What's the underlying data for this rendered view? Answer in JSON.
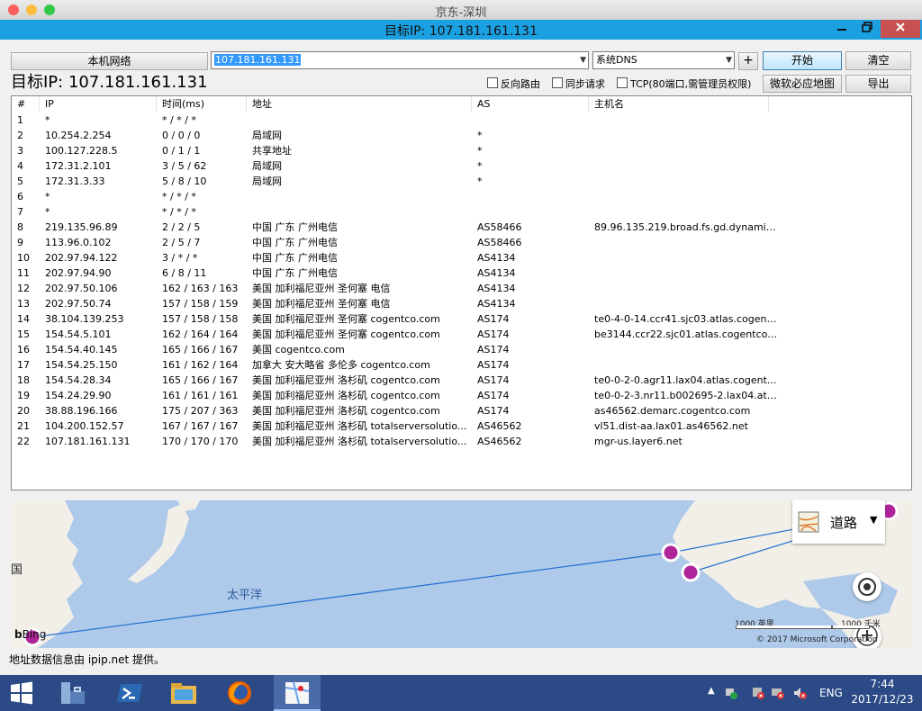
{
  "window": {
    "mac_title": "京东-深圳",
    "title": "目标IP: 107.181.161.131",
    "min_icon": "minimize-icon",
    "max_icon": "restore-icon",
    "close_icon": "close-icon"
  },
  "toolbar": {
    "local_network_label": "本机网络",
    "target_value": "107.181.161.131",
    "dns_value": "系统DNS",
    "plus_label": "+",
    "start_label": "开始",
    "clear_label": "清空",
    "bing_map_label": "微软必应地图",
    "export_label": "导出",
    "reverse_route_label": "反向路由",
    "sync_request_label": "同步请求",
    "tcp_label": "TCP(80端口,需管理员权限)"
  },
  "target_heading": "目标IP:  107.181.161.131",
  "table": {
    "columns": [
      "#",
      "IP",
      "时间(ms)",
      "地址",
      "AS",
      "主机名"
    ],
    "rows": [
      [
        "1",
        "*",
        "* / * / *",
        "",
        "",
        ""
      ],
      [
        "2",
        "10.254.2.254",
        "0 / 0 / 0",
        "局域网",
        "*",
        ""
      ],
      [
        "3",
        "100.127.228.5",
        "0 / 1 / 1",
        "共享地址",
        "*",
        ""
      ],
      [
        "4",
        "172.31.2.101",
        "3 / 5 / 62",
        "局域网",
        "*",
        ""
      ],
      [
        "5",
        "172.31.3.33",
        "5 / 8 / 10",
        "局域网",
        "*",
        ""
      ],
      [
        "6",
        "*",
        "* / * / *",
        "",
        "",
        ""
      ],
      [
        "7",
        "*",
        "* / * / *",
        "",
        "",
        ""
      ],
      [
        "8",
        "219.135.96.89",
        "2 / 2 / 5",
        "中国 广东 广州电信",
        "AS58466",
        "89.96.135.219.broad.fs.gd.dynamic..."
      ],
      [
        "9",
        "113.96.0.102",
        "2 / 5 / 7",
        "中国 广东 广州电信",
        "AS58466",
        ""
      ],
      [
        "10",
        "202.97.94.122",
        "3 / * / *",
        "中国 广东 广州电信",
        "AS4134",
        ""
      ],
      [
        "11",
        "202.97.94.90",
        "6 / 8 / 11",
        "中国 广东 广州电信",
        "AS4134",
        ""
      ],
      [
        "12",
        "202.97.50.106",
        "162 / 163 / 163",
        "美国 加利福尼亚州 圣何塞 电信",
        "AS4134",
        ""
      ],
      [
        "13",
        "202.97.50.74",
        "157 / 158 / 159",
        "美国 加利福尼亚州 圣何塞 电信",
        "AS4134",
        ""
      ],
      [
        "14",
        "38.104.139.253",
        "157 / 158 / 158",
        "美国 加利福尼亚州 圣何塞 cogentco.com",
        "AS174",
        "te0-4-0-14.ccr41.sjc03.atlas.cogent..."
      ],
      [
        "15",
        "154.54.5.101",
        "162 / 164 / 164",
        "美国 加利福尼亚州 圣何塞 cogentco.com",
        "AS174",
        "be3144.ccr22.sjc01.atlas.cogentco...."
      ],
      [
        "16",
        "154.54.40.145",
        "165 / 166 / 167",
        "美国 cogentco.com",
        "AS174",
        ""
      ],
      [
        "17",
        "154.54.25.150",
        "161 / 162 / 164",
        "加拿大 安大略省 多伦多 cogentco.com",
        "AS174",
        ""
      ],
      [
        "18",
        "154.54.28.34",
        "165 / 166 / 167",
        "美国 加利福尼亚州 洛杉矶 cogentco.com",
        "AS174",
        "te0-0-2-0.agr11.lax04.atlas.cogent..."
      ],
      [
        "19",
        "154.24.29.90",
        "161 / 161 / 161",
        "美国 加利福尼亚州 洛杉矶 cogentco.com",
        "AS174",
        "te0-0-2-3.nr11.b002695-2.lax04.atl..."
      ],
      [
        "20",
        "38.88.196.166",
        "175 / 207 / 363",
        "美国 加利福尼亚州 洛杉矶 cogentco.com",
        "AS174",
        "as46562.demarc.cogentco.com"
      ],
      [
        "21",
        "104.200.152.57",
        "167 / 167 / 167",
        "美国 加利福尼亚州 洛杉矶 totalserversolutio...",
        "AS46562",
        "vl51.dist-aa.lax01.as46562.net"
      ],
      [
        "22",
        "107.181.161.131",
        "170 / 170 / 170",
        "美国 加利福尼亚州 洛杉矶 totalserversolutio...",
        "AS46562",
        "mgr-us.layer6.net"
      ]
    ]
  },
  "map": {
    "ocean_label": "太平洋",
    "country_label": "国",
    "road_label": "道路",
    "bing_label": "Bing",
    "copyright": "© 2017 Microsoft Corporation",
    "scale_miles": "1000 英里",
    "scale_km": "1000 千米",
    "water_color": "#aec9e9",
    "land_color": "#f2efe9",
    "route_color": "#1f6fd1",
    "marker_color": "#b0259a"
  },
  "status_text": "地址数据信息由 ipip.net 提供。",
  "taskbar": {
    "lang": "ENG",
    "time": "7:44",
    "date": "2017/12/23"
  }
}
